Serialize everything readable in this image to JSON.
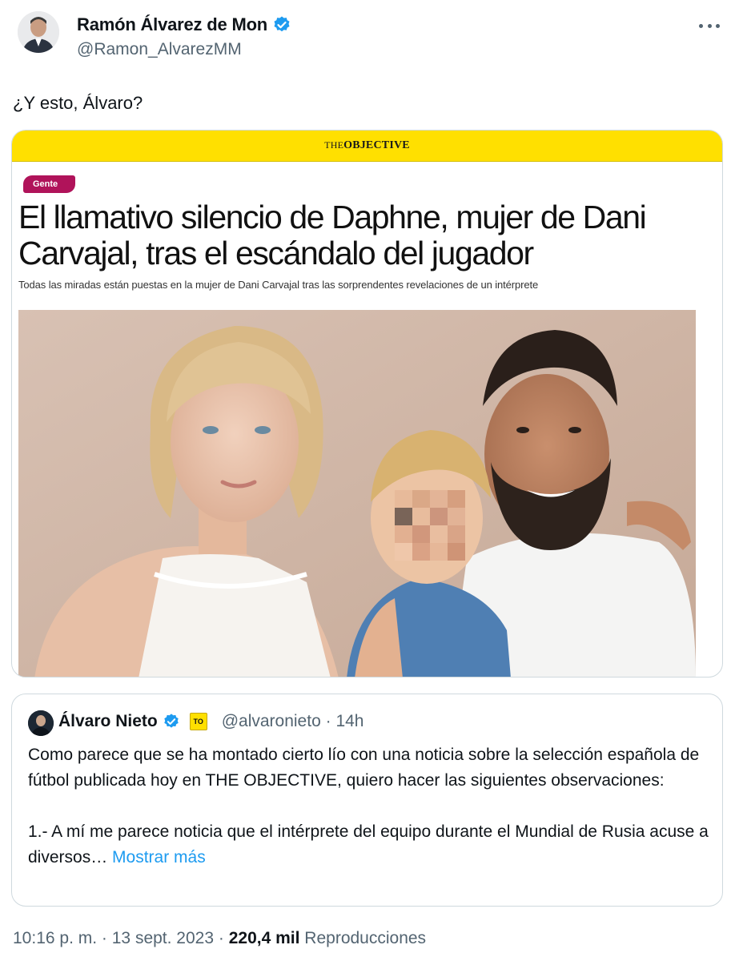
{
  "author": {
    "name": "Ramón Álvarez de Mon",
    "handle": "@Ramon_AlvarezMM",
    "verified_icon": "verified-badge-icon"
  },
  "tweet": {
    "text": "¿Y esto, Álvaro?"
  },
  "article": {
    "brand_prefix": "THE",
    "brand_suffix": "OBJECTIVE",
    "section": "Gente",
    "headline": "El llamativo silencio de Daphne, mujer de Dani Carvajal, tras el escándalo del jugador",
    "subhead": "Todas las miradas están puestas en la mujer de Dani Carvajal tras las sorprendentes revelaciones de un intérprete",
    "brand_color": "#ffe000",
    "tag_color": "#b0135a"
  },
  "quote": {
    "name": "Álvaro Nieto",
    "org_badge": "TO",
    "handle": "@alvaronieto",
    "separator": "·",
    "time": "14h",
    "paragraph1": "Como parece que se ha montado cierto lío con una noticia sobre la selección española de fútbol publicada hoy en THE OBJECTIVE, quiero hacer las siguientes observaciones:",
    "paragraph2": "1.- A mí me parece noticia que el intérprete del equipo durante el Mundial de Rusia acuse a diversos…",
    "show_more": "Mostrar más"
  },
  "footer": {
    "time": "10:16 p. m.",
    "sep1": "·",
    "date": "13 sept. 2023",
    "sep2": "·",
    "views": "220,4 mil",
    "views_label": "Reproducciones"
  },
  "colors": {
    "link": "#1d9bf0",
    "muted": "#536471",
    "text": "#0f1419",
    "verified": "#1d9bf0"
  }
}
